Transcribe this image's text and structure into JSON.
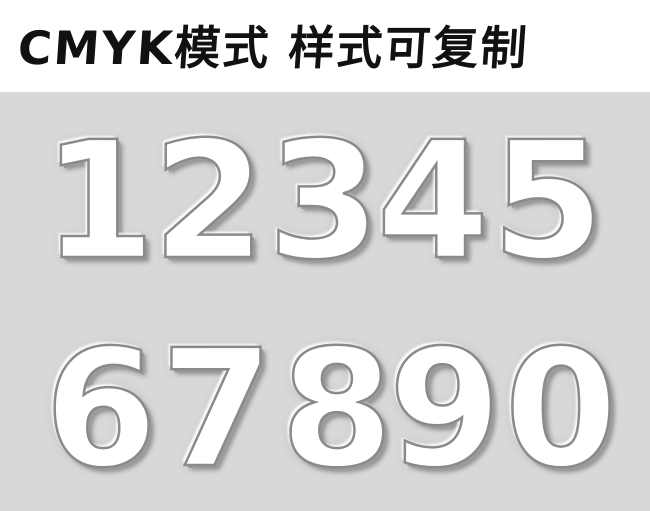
{
  "header": {
    "title_part1": "CMYK模式",
    "title_part2": "样式可复制"
  },
  "digits": {
    "row1": [
      "1",
      "2",
      "3",
      "4",
      "5"
    ],
    "row2": [
      "6",
      "7",
      "8",
      "9",
      "0"
    ]
  },
  "colors": {
    "background_top": "#ffffff",
    "background_canvas": "#d8d8d8",
    "title_text": "#111111",
    "digit_fill": "#f3f3f3",
    "digit_outline": "#8a8a8a"
  }
}
